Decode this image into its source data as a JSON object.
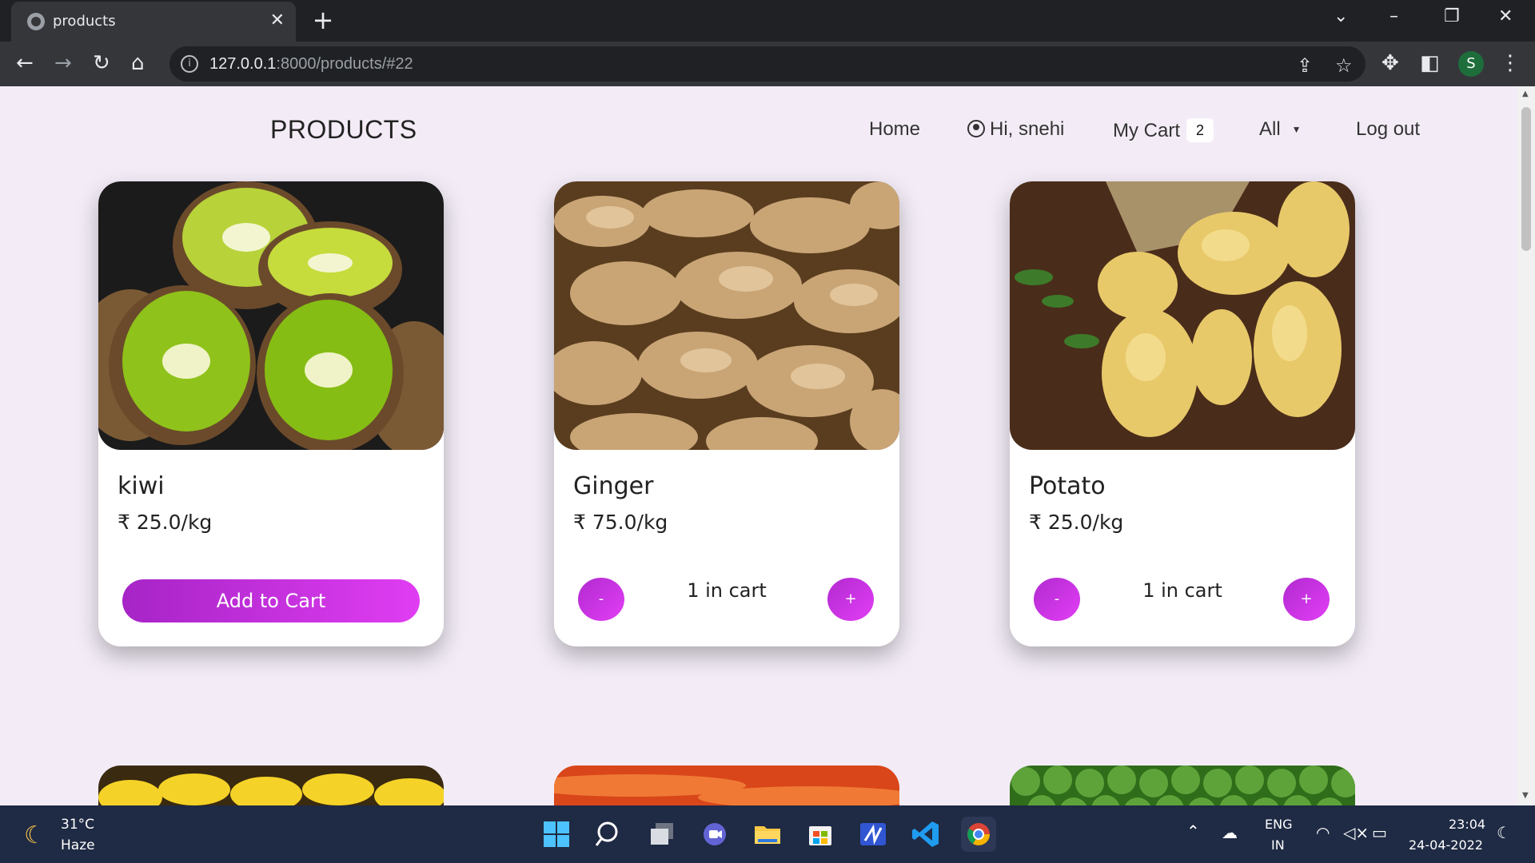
{
  "browser": {
    "tab_title": "products",
    "url_host": "127.0.0.1",
    "url_rest": ":8000/products/#22",
    "profile_initial": "S"
  },
  "header": {
    "brand": "PRODUCTS",
    "nav_home": "Home",
    "nav_user": "Hi, snehi",
    "nav_cart": "My Cart",
    "cart_count": "2",
    "nav_category": "All",
    "nav_logout": "Log out"
  },
  "products": [
    {
      "name": "kiwi",
      "price": "₹ 25.0/kg",
      "action": "Add to Cart"
    },
    {
      "name": "Ginger",
      "price": "₹ 75.0/kg",
      "qty_text": "1 in cart",
      "minus": "-",
      "plus": "+"
    },
    {
      "name": "Potato",
      "price": "₹ 25.0/kg",
      "qty_text": "1 in cart",
      "minus": "-",
      "plus": "+"
    }
  ],
  "taskbar": {
    "temp": "31°C",
    "weather": "Haze",
    "lang_top": "ENG",
    "lang_bottom": "IN",
    "time": "23:04",
    "date": "24-04-2022"
  },
  "colors": {
    "accent_start": "#a624c6",
    "accent_end": "#e03df2",
    "page_bg": "#f3ecf7"
  }
}
